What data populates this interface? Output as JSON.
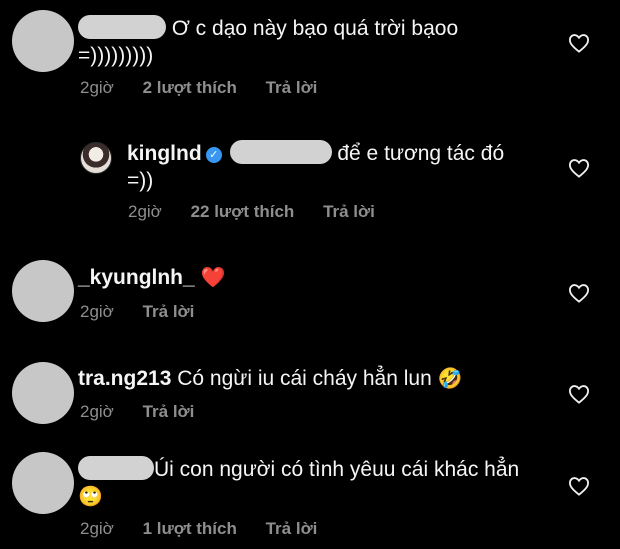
{
  "comments": [
    {
      "prefix": "",
      "text": "Ơ c dạo này bạo quá trời bạoo",
      "text2": "=)))))))))",
      "time": "2giờ",
      "likes": "2 lượt thích",
      "reply": "Trả lời"
    },
    {
      "username": "kinglnd",
      "text": "để e tương tác đó",
      "text2": "=))",
      "time": "2giờ",
      "likes": "22 lượt thích",
      "reply": "Trả lời"
    },
    {
      "username": "_kyunglnh_",
      "emoji": "❤️",
      "time": "2giờ",
      "reply": "Trả lời"
    },
    {
      "username": "tra.ng213",
      "text": "Có ngừi iu cái cháy hẳn lun",
      "emoji": "🤣",
      "time": "2giờ",
      "reply": "Trả lời"
    },
    {
      "text": "Úi con người có tình yêuu cái khác hẳn",
      "emoji": "🙄",
      "time": "2giờ",
      "likes": "1 lượt thích",
      "reply": "Trả lời"
    }
  ],
  "icons": {
    "heart": "heart-outline-icon",
    "verified": "verified-badge-icon"
  },
  "colors": {
    "background": "#000000",
    "meta": "#8e8e8e",
    "verified": "#3897f0",
    "redacted": "#d2d2d2"
  }
}
